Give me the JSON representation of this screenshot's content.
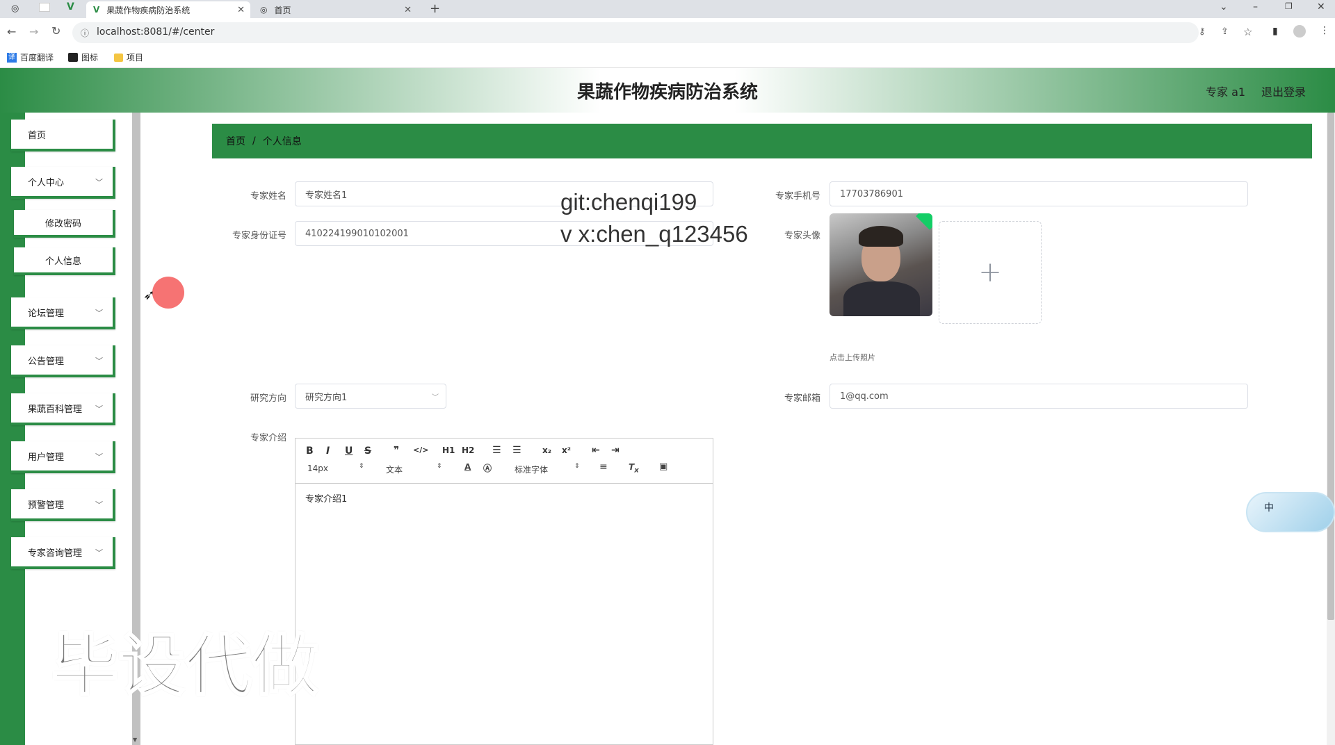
{
  "browser": {
    "tabs": [
      {
        "label": "果蔬作物疾病防治系统"
      },
      {
        "label": "首页"
      }
    ],
    "url": "localhost:8081/#/center",
    "bookmarks": [
      "百度翻译",
      "图标",
      "项目"
    ]
  },
  "header": {
    "title": "果蔬作物疾病防治系统",
    "user": "专家 a1",
    "logout": "退出登录"
  },
  "sidebar": {
    "home": "首页",
    "personal_center": "个人中心",
    "change_password": "修改密码",
    "personal_info": "个人信息",
    "items": [
      "论坛管理",
      "公告管理",
      "果蔬百科管理",
      "用户管理",
      "预警管理",
      "专家咨询管理"
    ]
  },
  "breadcrumb": {
    "home": "首页",
    "separator": "/",
    "current": "个人信息"
  },
  "form": {
    "name_label": "专家姓名",
    "name_value": "专家姓名1",
    "phone_label": "专家手机号",
    "phone_value": "17703786901",
    "id_label": "专家身份证号",
    "id_value": "410224199010102001",
    "avatar_label": "专家头像",
    "upload_hint": "点击上传照片",
    "research_label": "研究方向",
    "research_value": "研究方向1",
    "email_label": "专家邮箱",
    "email_value": "1@qq.com",
    "intro_label": "专家介绍",
    "intro_value": "专家介绍1"
  },
  "editor_toolbar": {
    "font_size": "14px",
    "text_type": "文本",
    "font_family": "标准字体"
  },
  "overlay": {
    "line1": "git:chenqi199",
    "line2": "v x:chen_q123456",
    "big": "毕设代做",
    "ime": "中"
  },
  "colors": {
    "accent": "#2b8c45"
  }
}
